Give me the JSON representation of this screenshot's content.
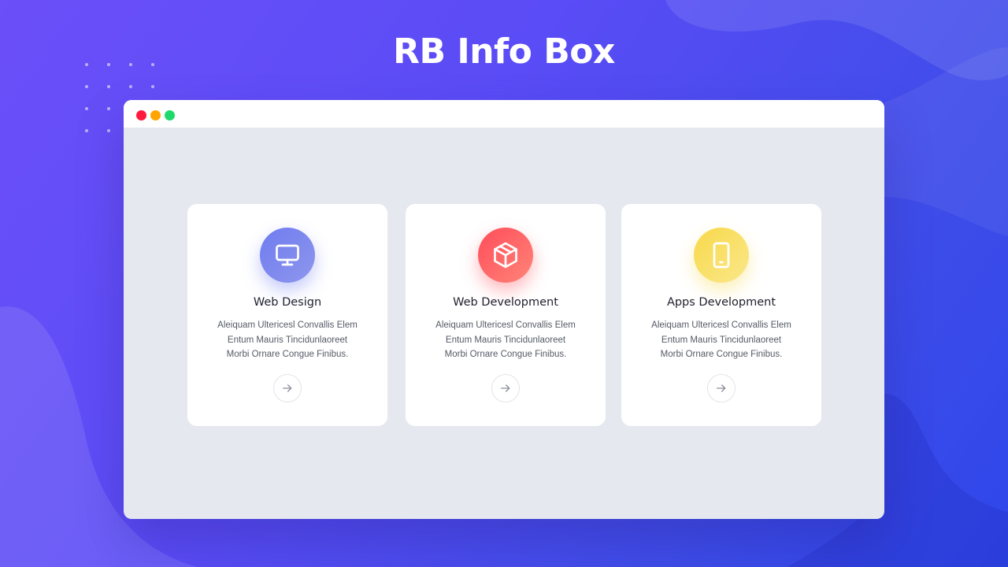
{
  "title": "RB Info Box",
  "colors": {
    "window_close": "#ff1a3d",
    "window_minimize": "#ffa500",
    "window_maximize": "#1fd96a"
  },
  "cards": [
    {
      "title": "Web Design",
      "icon": "monitor-icon",
      "text_lines": [
        "Aleiquam Ultericesl Convallis Elem",
        "Entum Mauris Tincidunlaoreet",
        "Morbi Ornare Congue Finibus."
      ],
      "icon_gradient": [
        "#6f7cf0",
        "#8e96ec"
      ]
    },
    {
      "title": "Web Development",
      "icon": "cube-icon",
      "text_lines": [
        "Aleiquam Ultericesl Convallis Elem",
        "Entum Mauris Tincidunlaoreet",
        "Morbi Ornare Congue Finibus."
      ],
      "icon_gradient": [
        "#ff4d5a",
        "#ff8478"
      ]
    },
    {
      "title": "Apps Development",
      "icon": "mobile-icon",
      "text_lines": [
        "Aleiquam Ultericesl Convallis Elem",
        "Entum Mauris Tincidunlaoreet",
        "Morbi Ornare Congue Finibus."
      ],
      "icon_gradient": [
        "#f7d94a",
        "#fbe78a"
      ]
    }
  ],
  "arrow_icon": "arrow-right-icon"
}
